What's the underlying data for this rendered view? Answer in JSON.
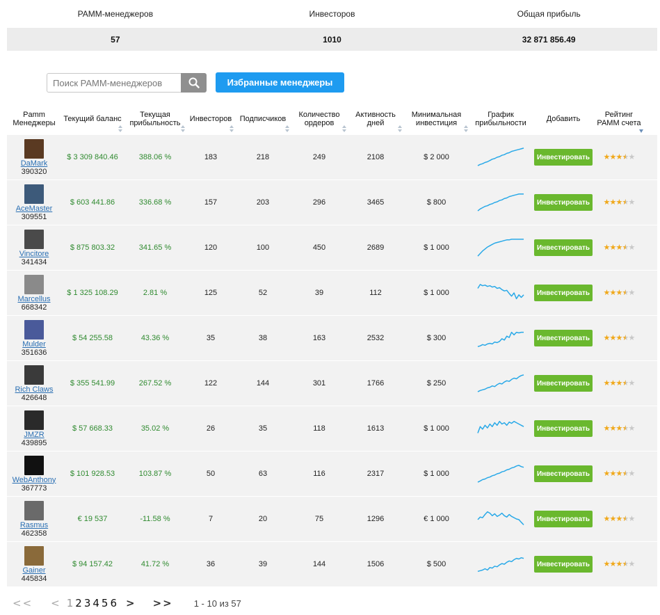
{
  "summary": {
    "headers": [
      "PAMM-менеджеров",
      "Инвесторов",
      "Общая прибыль"
    ],
    "values": [
      "57",
      "1010",
      "32 871 856.49"
    ]
  },
  "search": {
    "placeholder": "Поиск PAMM-менеджеров",
    "favorites_label": "Избранные менеджеры"
  },
  "table": {
    "headers": [
      "Pamm Менеджеры",
      "Текущий баланс",
      "Текущая прибыльность",
      "Инвесторов",
      "Подписчиков",
      "Количество ордеров",
      "Активность дней",
      "Минимальная инвестиция",
      "График прибыльности",
      "Добавить",
      "Рейтинг PAMM счета"
    ],
    "invest_label": "Инвестировать",
    "rows": [
      {
        "name": "DaMark",
        "id": "390320",
        "balance": "$ 3 309 840.46",
        "profit": "388.06 %",
        "investors": "183",
        "subscribers": "218",
        "orders": "249",
        "days": "2108",
        "min": "$ 2 000",
        "rating": 3.5,
        "avatar": "#5a3a22",
        "spark": [
          2,
          4,
          5,
          7,
          8,
          10,
          12,
          13,
          15,
          16,
          18,
          19,
          21,
          22,
          24,
          25,
          26,
          27,
          28,
          29
        ]
      },
      {
        "name": "AceMaster",
        "id": "309551",
        "balance": "$ 603 441.86",
        "profit": "336.68 %",
        "investors": "157",
        "subscribers": "203",
        "orders": "296",
        "days": "3465",
        "min": "$ 800",
        "rating": 3.5,
        "avatar": "#3d5a7a",
        "spark": [
          2,
          5,
          7,
          9,
          10,
          12,
          13,
          15,
          16,
          18,
          19,
          21,
          22,
          24,
          25,
          26,
          27,
          28,
          28,
          28
        ]
      },
      {
        "name": "Vincitore",
        "id": "341434",
        "balance": "$ 875 803.32",
        "profit": "341.65 %",
        "investors": "120",
        "subscribers": "100",
        "orders": "450",
        "days": "2689",
        "min": "$ 1 000",
        "rating": 3.5,
        "avatar": "#4a4a4a",
        "spark": [
          2,
          6,
          10,
          13,
          16,
          18,
          20,
          22,
          23,
          24,
          25,
          26,
          27,
          27,
          28,
          28,
          28,
          28,
          28,
          28
        ]
      },
      {
        "name": "Marcellus",
        "id": "668342",
        "balance": "$ 1 325 108.29",
        "profit": "2.81 %",
        "investors": "125",
        "subscribers": "52",
        "orders": "39",
        "days": "112",
        "min": "$ 1 000",
        "rating": 3.5,
        "avatar": "#8a8a8a",
        "spark": [
          22,
          28,
          26,
          27,
          25,
          26,
          24,
          25,
          22,
          23,
          20,
          18,
          19,
          14,
          10,
          15,
          6,
          12,
          8,
          12
        ]
      },
      {
        "name": "Mulder",
        "id": "351636",
        "balance": "$ 54 255.58",
        "profit": "43.36 %",
        "investors": "35",
        "subscribers": "38",
        "orders": "163",
        "days": "2532",
        "min": "$ 300",
        "rating": 3.5,
        "avatar": "#4a5a9a",
        "spark": [
          2,
          3,
          5,
          4,
          6,
          7,
          6,
          9,
          8,
          10,
          14,
          12,
          18,
          16,
          24,
          20,
          24,
          23,
          24,
          24
        ]
      },
      {
        "name": "Rich Claws",
        "id": "426648",
        "balance": "$ 355 541.99",
        "profit": "267.52 %",
        "investors": "122",
        "subscribers": "144",
        "orders": "301",
        "days": "1766",
        "min": "$ 250",
        "rating": 3.5,
        "avatar": "#3a3a3a",
        "spark": [
          2,
          4,
          5,
          6,
          8,
          9,
          11,
          10,
          13,
          15,
          14,
          17,
          19,
          18,
          21,
          23,
          22,
          25,
          27,
          28
        ]
      },
      {
        "name": "JMZR",
        "id": "439895",
        "balance": "$ 57 668.33",
        "profit": "35.02 %",
        "investors": "26",
        "subscribers": "35",
        "orders": "118",
        "days": "1613",
        "min": "$ 1 000",
        "rating": 3.5,
        "avatar": "#2a2a2a",
        "spark": [
          8,
          18,
          14,
          20,
          16,
          22,
          18,
          24,
          20,
          26,
          22,
          24,
          20,
          25,
          23,
          26,
          24,
          22,
          20,
          18
        ]
      },
      {
        "name": "WebAnthony",
        "id": "367773",
        "balance": "$ 101 928.53",
        "profit": "103.87 %",
        "investors": "50",
        "subscribers": "63",
        "orders": "116",
        "days": "2317",
        "min": "$ 1 000",
        "rating": 3.5,
        "avatar": "#111111",
        "spark": [
          2,
          4,
          6,
          7,
          9,
          10,
          12,
          13,
          15,
          16,
          18,
          19,
          21,
          22,
          24,
          25,
          27,
          28,
          26,
          25
        ]
      },
      {
        "name": "Rasmus",
        "id": "462358",
        "balance": "€ 19 537",
        "profit": "-11.58 %",
        "investors": "7",
        "subscribers": "20",
        "orders": "75",
        "days": "1296",
        "min": "€ 1 000",
        "rating": 3.5,
        "avatar": "#6a6a6a",
        "spark": [
          14,
          18,
          17,
          22,
          26,
          24,
          20,
          23,
          19,
          21,
          24,
          20,
          18,
          22,
          19,
          17,
          15,
          14,
          10,
          6
        ]
      },
      {
        "name": "Gainer",
        "id": "445834",
        "balance": "$ 94 157.42",
        "profit": "41.72 %",
        "investors": "36",
        "subscribers": "39",
        "orders": "144",
        "days": "1506",
        "min": "$ 500",
        "rating": 3.5,
        "avatar": "#8a6a3a",
        "spark": [
          4,
          5,
          6,
          8,
          6,
          10,
          9,
          12,
          11,
          14,
          16,
          15,
          18,
          20,
          19,
          22,
          24,
          23,
          25,
          24
        ]
      }
    ]
  },
  "pager": {
    "first": "<<",
    "prev": "<",
    "pages": [
      "1",
      "2",
      "3",
      "4",
      "5",
      "6"
    ],
    "next": ">",
    "last": ">>",
    "info": "1 - 10 из 57"
  },
  "colors": {
    "accent": "#1e9bf0",
    "invest": "#6ab82e",
    "profit": "#2f8a2f",
    "spark": "#29a9e8",
    "star": "#f0a81a"
  },
  "icons": [
    "search-icon",
    "star-icon",
    "sort-icon"
  ]
}
